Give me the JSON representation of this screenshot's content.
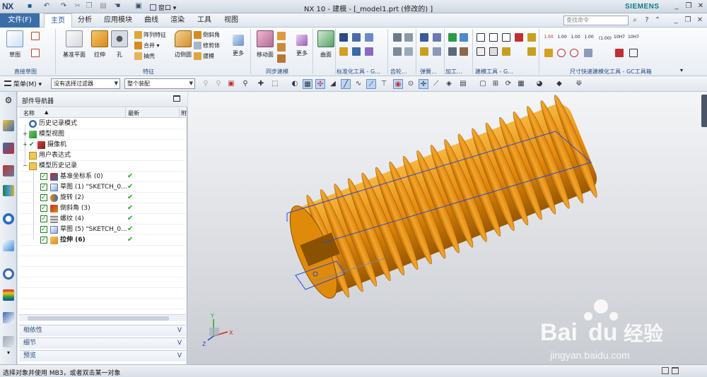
{
  "titlebar": {
    "app_logo": "NX",
    "title": "NX 10 - 建模 - [_model1.prt  (修改的) ]",
    "brand": "SIEMENS",
    "window_menu": "窗口",
    "icons": [
      "save-icon",
      "undo-icon",
      "redo-icon",
      "cut-icon",
      "copy-icon",
      "paste-icon",
      "touch-mode-icon",
      "switch-window-icon"
    ]
  },
  "menubar": {
    "file_label": "文件(F)",
    "tabs": [
      "主页",
      "分析",
      "应用模块",
      "曲线",
      "渲染",
      "工具",
      "视图"
    ],
    "active_tab": "主页",
    "search_placeholder": "查找命令"
  },
  "ribbon": {
    "groups": {
      "direct_sketch": "直接草图",
      "feature": "特征",
      "sync_modeling": "同步建模",
      "std_parts": "标准化工具 - G...",
      "gear": "齿轮...",
      "spring": "弹簧...",
      "machining": "加工...",
      "build_tools": "建模工具 - G...",
      "dim_tools": "尺寸快速建模化工具 - GC工具箱"
    },
    "buttons": {
      "sketch": "草图",
      "datum_plane": "基准平面",
      "extrude": "拉伸",
      "hole": "孔",
      "pattern_feature": "阵列特征",
      "unite": "合并",
      "shell": "抽壳",
      "edge_blend": "边倒圆",
      "chamfer": "倒斜角",
      "trim_body": "修剪体",
      "draft": "拔模",
      "more": "更多",
      "move_face": "移动面",
      "more2": "更多",
      "surface": "曲面"
    },
    "dim_labels": [
      "1.00",
      "1.00",
      "1.00",
      "1.00",
      "(1.00)",
      "10H7",
      "10H7"
    ]
  },
  "selbar": {
    "menu_label": "菜单(M)",
    "filter_value": "没有选择过滤器",
    "scope_value": "整个装配"
  },
  "navigator": {
    "title": "部件导航器",
    "col_name": "名称",
    "col_latest": "最新",
    "col_extra": "附",
    "rows": [
      {
        "label": "历史记录模式",
        "latest": ""
      },
      {
        "label": "模型视图",
        "latest": ""
      },
      {
        "label": "摄像机",
        "latest": ""
      },
      {
        "label": "用户表达式",
        "latest": ""
      },
      {
        "label": "模型历史记录",
        "latest": ""
      },
      {
        "label": "基准坐标系 (0)",
        "latest": "✔"
      },
      {
        "label": "草图 (1) \"SKETCH_0...",
        "latest": "✔"
      },
      {
        "label": "旋转 (2)",
        "latest": "✔"
      },
      {
        "label": "倒斜角 (3)",
        "latest": "✔"
      },
      {
        "label": "螺纹 (4)",
        "latest": "✔"
      },
      {
        "label": "草图 (5) \"SKETCH_0...",
        "latest": "✔"
      },
      {
        "label": "拉伸 (6)",
        "latest": "✔"
      }
    ],
    "panels": [
      "相依性",
      "细节",
      "预览"
    ]
  },
  "viewport": {
    "thread_color": "#e08a0a",
    "thread_shadow": "#9a5a00",
    "sketch_color": "#2a4ad8",
    "triad_labels": [
      "Y",
      "X",
      "Z"
    ],
    "watermark_brand": "Bai",
    "watermark_brand2": "du",
    "watermark_cn": "经验",
    "watermark_url": "jingyan.baidu.com"
  },
  "status": {
    "text": "选择对象并使用 MB3，或者双击某一对象"
  }
}
